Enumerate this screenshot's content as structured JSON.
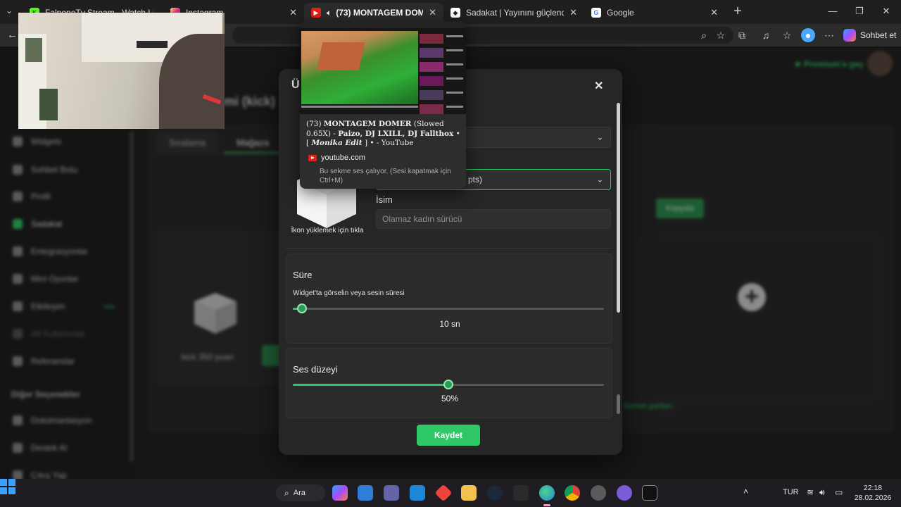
{
  "browser": {
    "tabs": [
      {
        "title": "FalponeTv Stream - Watch Live o…",
        "favicon": "kick-icon",
        "color": "#53fc18"
      },
      {
        "title": "Instagram",
        "favicon": "instagram-icon",
        "color": "#d62976"
      },
      {
        "title": "(73) MONTAGEM DOMER (Slo…",
        "favicon": "youtube-icon",
        "color": "#e62117",
        "active": true
      },
      {
        "title": "Sadakat | Yayınını güçlendirmek içi…",
        "favicon": "botrix-icon",
        "color": "#ffffff"
      },
      {
        "title": "Google",
        "favicon": "google-icon",
        "color": "#4285f4"
      }
    ],
    "copilot_label": "Sohbet et"
  },
  "page": {
    "premium_label": "Premium'a geç",
    "title_fragment": "mi (kick)",
    "tabs": [
      "Sıralama",
      "Mağaza"
    ],
    "sidebar": {
      "items": [
        {
          "label": "Widgets"
        },
        {
          "label": "Sohbet Botu"
        },
        {
          "label": "Profil"
        },
        {
          "label": "Sadakat",
          "active": true
        },
        {
          "label": "Entegrasyonlar"
        },
        {
          "label": "Mini Oyunlar"
        },
        {
          "label": "Etkileşim",
          "badge": "new"
        },
        {
          "label": "Alt Kullanıcılar"
        },
        {
          "label": "Referanslar"
        }
      ],
      "section": "Diğer Seçenekler",
      "more_items": [
        {
          "label": "Dokümantasyon"
        },
        {
          "label": "Destek AI"
        },
        {
          "label": "Çıkış Yap"
        }
      ]
    },
    "item_points": "kick 350 puan",
    "copy_label": "Kopyala",
    "terms_label": "hizmet şartları."
  },
  "modal": {
    "title": "Ür",
    "item_select_value": "0 pts)",
    "icon_upload_label": "İkon yüklemek için tıkla",
    "name_label": "İsim",
    "name_placeholder": "Olamaz kadın sürücü",
    "duration": {
      "title": "Süre",
      "subtitle": "Widget'ta görselin veya sesin süresi",
      "value_label": "10 sn",
      "fraction": 0.03
    },
    "volume": {
      "title": "Ses düzeyi",
      "value_label": "50%",
      "fraction": 0.5
    },
    "save_label": "Kaydet"
  },
  "tooltip": {
    "title_prefix": "(73) ",
    "title_bold": "MONTAGEM DOMER",
    "title_rest": " (Slowed 0.65X) - ",
    "title_line2_bold": "Paizo, DJ LXILL, DJ Fallthox",
    "title_line2_mid": " • [ ",
    "title_line2_italic": "Monika Edit",
    "title_line2_end": " ] • - YouTube",
    "domain": "youtube.com",
    "audio_note": "Bu sekme ses çalıyor. (Sesi kapatmak için Ctrl+M)"
  },
  "taskbar": {
    "search_label": "Ara",
    "lang": "TUR",
    "time": "22:18",
    "date": "28.02.2026"
  }
}
